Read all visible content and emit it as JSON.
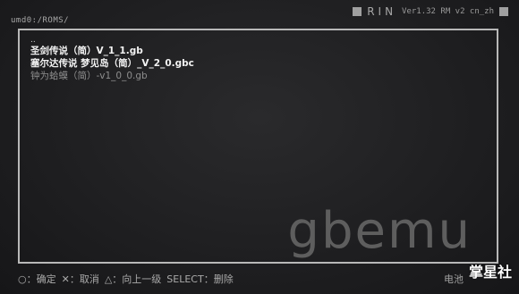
{
  "path": "umd0:/ROMS/",
  "title": {
    "name": "RIN",
    "version": "Ver1.32 RM v2 cn_zh"
  },
  "files": [
    {
      "name": "..",
      "style": "up"
    },
    {
      "name": "圣剑传说（简）V_1_1.gb",
      "style": "normal"
    },
    {
      "name": "塞尔达传说 梦见岛（简）_V_2_0.gbc",
      "style": "normal"
    },
    {
      "name": "钟为蛤蟆（简）-v1_0_0.gb",
      "style": "dim"
    }
  ],
  "logo": "gbemu",
  "controls": {
    "confirm": "○：确定",
    "cancel": "✕：取消",
    "up": "△：向上一级",
    "select": "SELECT：删除"
  },
  "battery": "电池",
  "watermark": "掌星社",
  "colors": {
    "background": "#1c1c1e",
    "panel_border": "#b8b8b8",
    "text": "#f2f2f2",
    "dim_text": "#8e8e8e",
    "logo": "#5e5e5e"
  }
}
